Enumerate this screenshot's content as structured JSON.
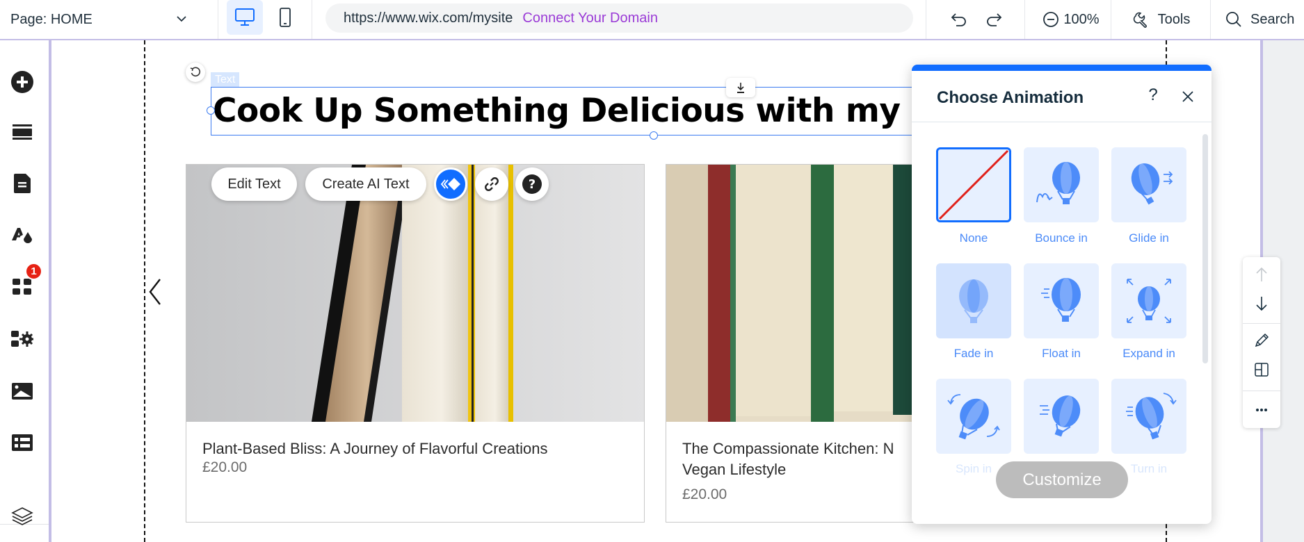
{
  "topbar": {
    "page_label": "Page: HOME",
    "url": "https://www.wix.com/mysite",
    "connect_domain": "Connect Your Domain",
    "zoom": "100%",
    "tools": "Tools",
    "search": "Search",
    "active_device": "desktop"
  },
  "sidebar": {
    "items": [
      {
        "name": "add-elements",
        "icon": "plus-circle-icon"
      },
      {
        "name": "sections",
        "icon": "sections-icon"
      },
      {
        "name": "pages",
        "icon": "page-icon"
      },
      {
        "name": "site-design",
        "icon": "theme-icon"
      },
      {
        "name": "apps",
        "icon": "apps-grid-icon",
        "badge": "1"
      },
      {
        "name": "business-apps",
        "icon": "apps-gear-icon"
      },
      {
        "name": "media",
        "icon": "image-icon"
      },
      {
        "name": "cms",
        "icon": "table-icon"
      },
      {
        "name": "layers",
        "icon": "layers-icon"
      }
    ]
  },
  "canvas": {
    "element_label": "Text",
    "heading": "Cook Up Something Delicious with my Recipes",
    "floating_actions": {
      "edit_text": "Edit Text",
      "create_ai_text": "Create AI Text",
      "animation_icon": "animation-icon",
      "link_icon": "link-icon",
      "help_icon": "help-icon"
    },
    "products": [
      {
        "title": "Plant-Based Bliss: A Journey of Flavorful Creations",
        "price": "£20.00"
      },
      {
        "title": "The Compassionate Kitchen: Nourishing a Vegan Lifestyle",
        "title_line1": "The Compassionate Kitchen: N",
        "title_line2": "Vegan Lifestyle",
        "price": "£20.00"
      }
    ]
  },
  "animation_panel": {
    "title": "Choose Animation",
    "help": "?",
    "selected": "None",
    "options": [
      {
        "label": "None"
      },
      {
        "label": "Bounce in"
      },
      {
        "label": "Glide in"
      },
      {
        "label": "Fade in"
      },
      {
        "label": "Float in"
      },
      {
        "label": "Expand in"
      },
      {
        "label": "Spin in"
      },
      {
        "label": ""
      },
      {
        "label": "Turn in"
      }
    ],
    "customize": "Customize"
  },
  "colors": {
    "accent": "#116dff",
    "connect_domain": "#9a3ad6",
    "badge": "#e62214",
    "canvas_border": "#c3bde6",
    "tile_bg": "#e7f0ff",
    "tile_label": "#4a8af8",
    "none_slash": "#e0211b"
  }
}
